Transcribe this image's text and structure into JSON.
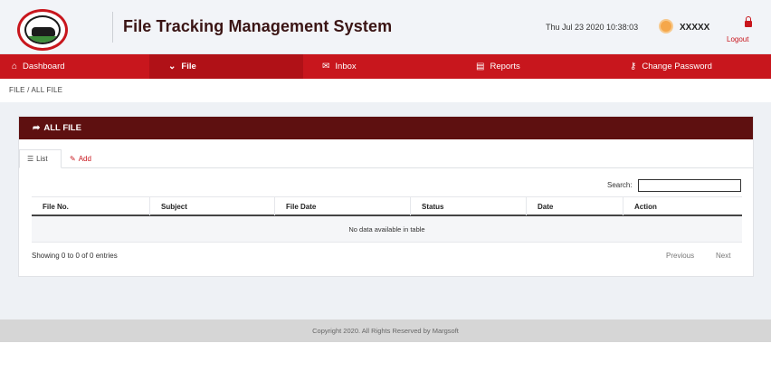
{
  "header": {
    "title": "File Tracking Management System",
    "datetime": "Thu Jul 23 2020 10:38:03",
    "user_name": "XXXXX",
    "logout_label": "Logout"
  },
  "nav": {
    "items": [
      {
        "label": "Dashboard",
        "icon": "home-icon"
      },
      {
        "label": "File",
        "icon": "chevrons-down-icon",
        "active": true
      },
      {
        "label": "Inbox",
        "icon": "mail-icon"
      },
      {
        "label": "Reports",
        "icon": "document-icon"
      },
      {
        "label": "Change Password",
        "icon": "key-icon"
      }
    ]
  },
  "breadcrumb": "FILE / ALL FILE",
  "panel": {
    "title": "ALL FILE",
    "tabs": [
      {
        "label": "List",
        "active": true
      },
      {
        "label": "Add"
      }
    ],
    "search_label": "Search:",
    "search_value": "",
    "columns": [
      "File No.",
      "Subject",
      "File Date",
      "Status",
      "Date",
      "Action"
    ],
    "empty_message": "No data available in table",
    "entries_info": "Showing 0 to 0 of 0 entries",
    "pagination": {
      "previous": "Previous",
      "next": "Next"
    }
  },
  "footer": "Copyright 2020. All Rights Reserved by Margsoft",
  "colors": {
    "primary_red": "#c8161d",
    "panel_header": "#5e1010",
    "title_text": "#3a1414"
  }
}
